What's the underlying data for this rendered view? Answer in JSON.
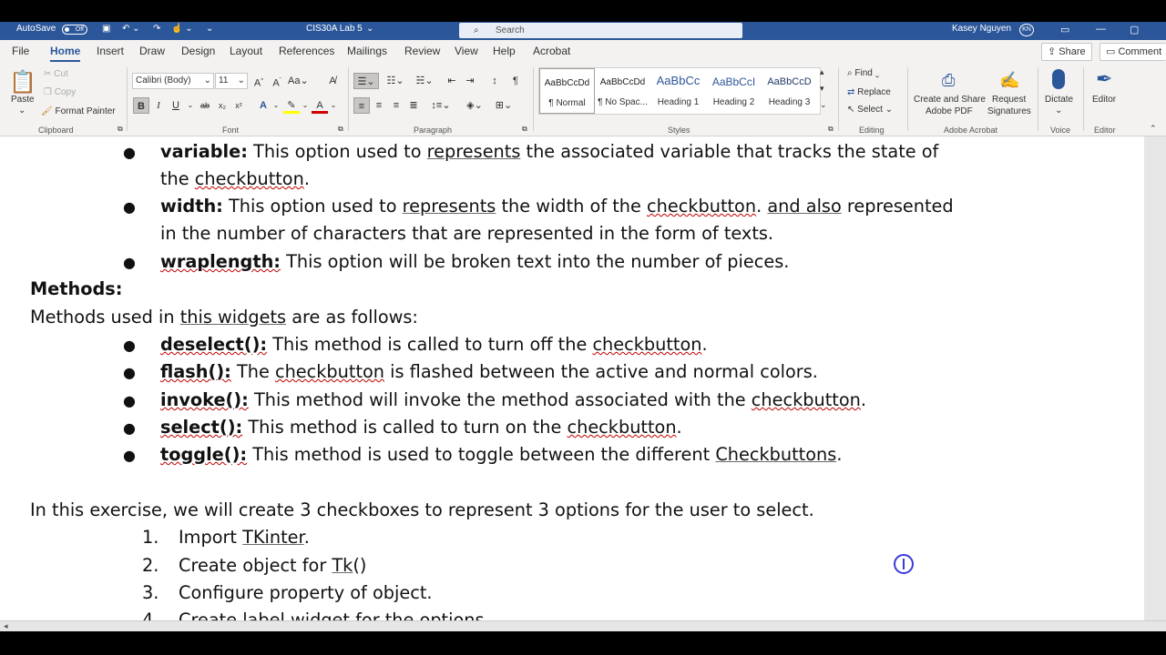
{
  "titlebar": {
    "autosave": "AutoSave",
    "autosave_state": "Off",
    "doc_name": "CIS30A Lab 5",
    "search_placeholder": "Search",
    "user_name": "Kasey Nguyen",
    "user_initials": "KN"
  },
  "tabs": [
    "File",
    "Home",
    "Insert",
    "Draw",
    "Design",
    "Layout",
    "References",
    "Mailings",
    "Review",
    "View",
    "Help",
    "Acrobat"
  ],
  "tab_share": "Share",
  "tab_comments": "Comment",
  "ribbon": {
    "clipboard": {
      "paste": "Paste",
      "cut": "Cut",
      "copy": "Copy",
      "format_painter": "Format Painter",
      "label": "Clipboard"
    },
    "font": {
      "family": "Calibri (Body)",
      "size": "11",
      "label": "Font"
    },
    "paragraph": {
      "label": "Paragraph"
    },
    "styles": {
      "label": "Styles",
      "items": [
        {
          "sample": "AaBbCcDd",
          "name": "¶ Normal"
        },
        {
          "sample": "AaBbCcDd",
          "name": "¶ No Spac..."
        },
        {
          "sample": "AaBbCc",
          "name": "Heading 1"
        },
        {
          "sample": "AaBbCcI",
          "name": "Heading 2"
        },
        {
          "sample": "AaBbCcD",
          "name": "Heading 3"
        }
      ]
    },
    "editing": {
      "find": "Find",
      "replace": "Replace",
      "select": "Select",
      "label": "Editing"
    },
    "acrobat": {
      "create_share_1": "Create and Share",
      "create_share_2": "Adobe PDF",
      "request_1": "Request",
      "request_2": "Signatures",
      "label": "Adobe Acrobat"
    },
    "voice": {
      "dictate": "Dictate",
      "label": "Voice"
    },
    "editor": {
      "editor": "Editor",
      "label": "Editor"
    }
  },
  "document": {
    "variable_term": "variable:",
    "variable_text_1": " This option used to ",
    "variable_represents": "represents",
    "variable_text_2": " the associated variable that tracks the state of",
    "variable_line2_a": "the ",
    "variable_line2_check": "checkbutton",
    "variable_line2_b": ".",
    "width_term": "width:",
    "width_text_1": " This option used to ",
    "width_represents": "represents",
    "width_text_2": " the width of the ",
    "width_check": "checkbutton",
    "width_text_3": ". ",
    "width_and_also": "and also",
    "width_text_4": " represented",
    "width_line2": "in the number of characters that are represented in the form of texts.",
    "wrap_term": "wraplength:",
    "wrap_text": " This option will be broken text into the number of pieces.",
    "methods_heading": "Methods:",
    "methods_intro_a": "Methods used in ",
    "methods_intro_u": "this widgets",
    "methods_intro_b": " are as follows:",
    "deselect_term": "deselect():",
    "deselect_text_a": " This method is called to turn off the ",
    "deselect_check": "checkbutton",
    "deselect_text_b": ".",
    "flash_term": "flash():",
    "flash_text_a": " The ",
    "flash_check": "checkbutton",
    "flash_text_b": " is flashed between the active and normal colors.",
    "invoke_term": "invoke():",
    "invoke_text_a": " This method will invoke the method associated with the ",
    "invoke_check": "checkbutton",
    "invoke_text_b": ".",
    "select_term": "select():",
    "select_text_a": " This method is called to turn on the ",
    "select_check": "checkbutton",
    "select_text_b": ".",
    "toggle_term": "toggle():",
    "toggle_text_a": " This method is used to toggle between the different ",
    "toggle_check": "Checkbuttons",
    "toggle_text_b": ".",
    "exercise_intro": "In this exercise, we will create 3 checkboxes to represent 3 options for the user to select.",
    "steps": [
      {
        "num": "1.",
        "text_a": "Import ",
        "text_u": "TKinter",
        "text_b": "."
      },
      {
        "num": "2.",
        "text_a": "Create object for ",
        "text_u": "Tk",
        "text_b": "()"
      },
      {
        "num": "3.",
        "text_a": "Configure property of object.",
        "text_u": "",
        "text_b": ""
      },
      {
        "num": "4.",
        "text_a": "Create label widget for the options",
        "text_u": "",
        "text_b": ""
      }
    ]
  }
}
